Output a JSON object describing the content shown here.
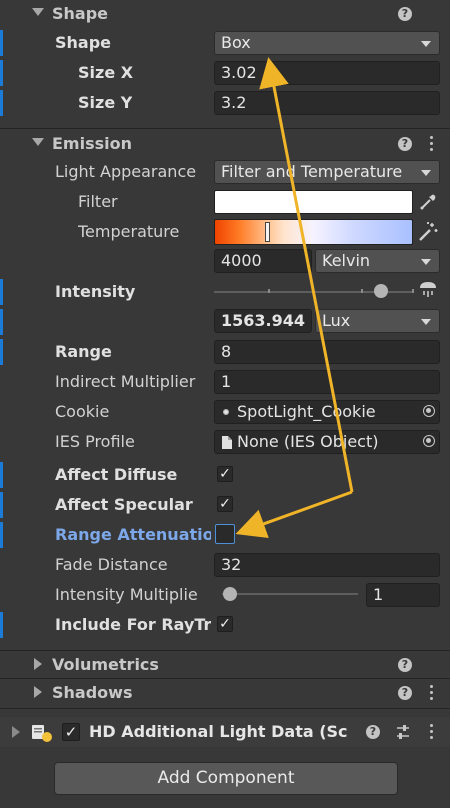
{
  "shape_section": {
    "header_title": "Shape",
    "shape_label": "Shape",
    "shape_value": "Box",
    "size_x_label": "Size X",
    "size_x_value": "3.02",
    "size_y_label": "Size Y",
    "size_y_value": "3.2"
  },
  "emission_section": {
    "header_title": "Emission",
    "light_appearance_label": "Light Appearance",
    "light_appearance_value": "Filter and Temperature",
    "filter_label": "Filter",
    "temperature_label": "Temperature",
    "temperature_value": "4000",
    "temperature_unit": "Kelvin",
    "intensity_label": "Intensity",
    "intensity_value": "1563.944",
    "intensity_unit": "Lux",
    "range_label": "Range",
    "range_value": "8",
    "indirect_multiplier_label": "Indirect Multiplier",
    "indirect_multiplier_value": "1",
    "cookie_label": "Cookie",
    "cookie_value": "SpotLight_Cookie",
    "ies_profile_label": "IES Profile",
    "ies_profile_value": "None (IES Object)",
    "affect_diffuse_label": "Affect Diffuse",
    "affect_diffuse_checked": true,
    "affect_specular_label": "Affect Specular",
    "affect_specular_checked": true,
    "range_attenuation_label": "Range Attenuatio",
    "range_attenuation_checked": false,
    "fade_distance_label": "Fade Distance",
    "fade_distance_value": "32",
    "intensity_multiplier_label": "Intensity Multiplie",
    "intensity_multiplier_value": "1",
    "include_raytracing_label": "Include For RayTr",
    "include_raytracing_checked": true
  },
  "collapsed_sections": {
    "volumetrics_title": "Volumetrics",
    "shadows_title": "Shadows"
  },
  "component": {
    "title": "HD Additional Light Data (Sc",
    "enabled": true
  },
  "add_component_label": "Add Component",
  "check_glyph": "✓",
  "help_glyph": "?",
  "icons": [
    "help-icon",
    "kebab-menu-icon",
    "eyedropper-icon",
    "wand-icon",
    "light-bulb-icon",
    "object-picker-icon",
    "file-icon",
    "settings-sliders-icon"
  ],
  "colors": {
    "background": "#383838",
    "accent_blue": "#1c7bd6",
    "highlight_label": "#7ca8ea",
    "annotation_arrow": "#f0b429"
  }
}
